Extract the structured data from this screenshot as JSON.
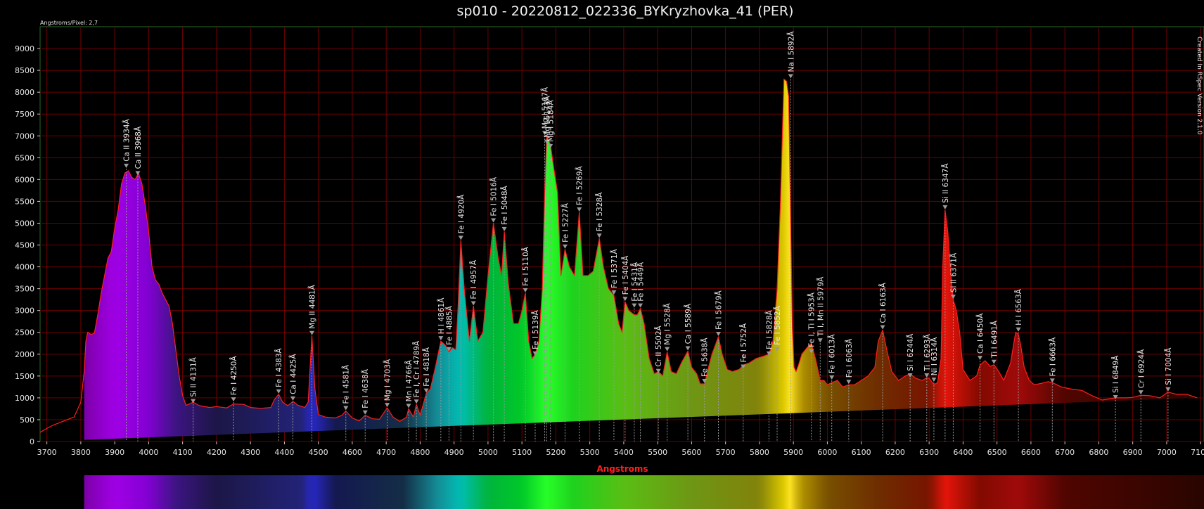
{
  "chart_data": {
    "type": "line",
    "title": "sp010 - 20220812_022336_BYKryzhovka_41 (PER)",
    "xlabel": "Angstroms",
    "ylabel": "",
    "dispersion_label": "Angstroms/Pixel: 2,7",
    "credit": "Created In RSpec Version 2.1.0",
    "xlim": [
      3680,
      7110
    ],
    "ylim": [
      0,
      9500
    ],
    "x_ticks": [
      3700,
      3800,
      3900,
      4000,
      4100,
      4200,
      4300,
      4400,
      4500,
      4600,
      4700,
      4800,
      4900,
      5000,
      5100,
      5200,
      5300,
      5400,
      5500,
      5600,
      5700,
      5800,
      5900,
      6000,
      6100,
      6200,
      6300,
      6400,
      6500,
      6600,
      6700,
      6800,
      6900,
      7000,
      7100
    ],
    "y_ticks": [
      0,
      500,
      1000,
      1500,
      2000,
      2500,
      3000,
      3500,
      4000,
      4500,
      5000,
      5500,
      6000,
      6500,
      7000,
      7500,
      8000,
      8500,
      9000
    ],
    "grid": true,
    "colors": {
      "curve": "#ff1e1e",
      "grid": "#6e0000",
      "frame": "#2a6a2a",
      "tick_text": "#e6e6e6",
      "axis_title": "#ff2020",
      "marker": "#9a9a9a"
    },
    "spectrum": {
      "x": [
        3680,
        3700,
        3720,
        3750,
        3780,
        3800,
        3810,
        3815,
        3820,
        3830,
        3840,
        3850,
        3860,
        3870,
        3880,
        3890,
        3900,
        3910,
        3920,
        3930,
        3940,
        3950,
        3960,
        3970,
        3980,
        3990,
        4000,
        4010,
        4020,
        4030,
        4040,
        4050,
        4060,
        4070,
        4080,
        4090,
        4100,
        4110,
        4120,
        4131,
        4150,
        4180,
        4200,
        4230,
        4250,
        4280,
        4300,
        4330,
        4360,
        4370,
        4383,
        4395,
        4410,
        4425,
        4440,
        4460,
        4470,
        4481,
        4490,
        4500,
        4520,
        4550,
        4570,
        4581,
        4600,
        4620,
        4638,
        4660,
        4680,
        4703,
        4720,
        4740,
        4760,
        4766,
        4780,
        4789,
        4800,
        4818,
        4830,
        4845,
        4861,
        4875,
        4885,
        4895,
        4905,
        4912,
        4920,
        4930,
        4945,
        4957,
        4970,
        4985,
        5000,
        5016,
        5030,
        5040,
        5048,
        5060,
        5075,
        5090,
        5100,
        5110,
        5120,
        5130,
        5139,
        5150,
        5160,
        5167,
        5173,
        5184,
        5195,
        5205,
        5215,
        5227,
        5240,
        5255,
        5269,
        5280,
        5295,
        5310,
        5328,
        5340,
        5355,
        5371,
        5385,
        5395,
        5404,
        5415,
        5431,
        5440,
        5449,
        5460,
        5475,
        5490,
        5502,
        5515,
        5528,
        5540,
        5555,
        5570,
        5589,
        5600,
        5615,
        5625,
        5638,
        5650,
        5660,
        5679,
        5690,
        5705,
        5720,
        5740,
        5752,
        5770,
        5790,
        5810,
        5828,
        5840,
        5852,
        5862,
        5872,
        5880,
        5886,
        5892,
        5897,
        5902,
        5908,
        5915,
        5925,
        5940,
        5953,
        5965,
        5979,
        5990,
        6000,
        6013,
        6030,
        6045,
        6063,
        6080,
        6100,
        6120,
        6140,
        6150,
        6163,
        6175,
        6190,
        6210,
        6230,
        6244,
        6260,
        6280,
        6293,
        6300,
        6314,
        6325,
        6335,
        6340,
        6347,
        6355,
        6362,
        6371,
        6380,
        6390,
        6400,
        6420,
        6440,
        6450,
        6465,
        6480,
        6491,
        6505,
        6520,
        6540,
        6555,
        6563,
        6570,
        6580,
        6595,
        6610,
        6630,
        6650,
        6663,
        6690,
        6720,
        6750,
        6780,
        6810,
        6849,
        6880,
        6900,
        6924,
        6950,
        6980,
        7004,
        7030,
        7060,
        7090,
        7110
      ],
      "y": [
        210,
        300,
        380,
        470,
        560,
        900,
        1600,
        2300,
        2500,
        2450,
        2480,
        2900,
        3400,
        3800,
        4200,
        4350,
        4900,
        5300,
        5900,
        6150,
        6200,
        6050,
        6000,
        6150,
        5900,
        5400,
        4800,
        4000,
        3700,
        3600,
        3400,
        3250,
        3100,
        2700,
        2100,
        1500,
        1050,
        830,
        860,
        900,
        820,
        780,
        800,
        770,
        860,
        850,
        780,
        760,
        780,
        950,
        1080,
        900,
        820,
        920,
        830,
        780,
        900,
        2420,
        1200,
        620,
        560,
        540,
        600,
        700,
        540,
        470,
        600,
        520,
        510,
        770,
        560,
        460,
        560,
        750,
        560,
        850,
        600,
        1100,
        1200,
        1700,
        2300,
        2200,
        2050,
        2150,
        2100,
        3100,
        4600,
        3500,
        2300,
        3100,
        2300,
        2500,
        3800,
        5000,
        4200,
        3800,
        4800,
        3600,
        2700,
        2700,
        3000,
        3400,
        2300,
        1900,
        2000,
        2300,
        3500,
        5700,
        7000,
        6800,
        6200,
        5700,
        3800,
        4400,
        4000,
        3800,
        5250,
        3800,
        3800,
        3900,
        4650,
        4000,
        3500,
        3350,
        2700,
        2500,
        3200,
        3000,
        2900,
        2900,
        3050,
        2700,
        1900,
        1550,
        1600,
        1500,
        2050,
        1600,
        1550,
        1800,
        2070,
        1700,
        1550,
        1320,
        1320,
        1700,
        2000,
        2400,
        2000,
        1650,
        1600,
        1650,
        1750,
        1800,
        1900,
        1950,
        2000,
        2300,
        3500,
        5500,
        8300,
        8250,
        7900,
        5000,
        2600,
        1700,
        1600,
        1750,
        2000,
        2150,
        2250,
        1900,
        1400,
        1400,
        1300,
        1350,
        1400,
        1250,
        1300,
        1300,
        1400,
        1500,
        1700,
        2300,
        2550,
        2100,
        1600,
        1400,
        1500,
        1550,
        1450,
        1400,
        1460,
        1450,
        1300,
        1350,
        1900,
        4000,
        5300,
        4800,
        4000,
        3250,
        3000,
        2500,
        1650,
        1400,
        1500,
        1750,
        1850,
        1720,
        1760,
        1600,
        1400,
        1800,
        2500,
        2450,
        2200,
        1700,
        1400,
        1300,
        1330,
        1370,
        1350,
        1250,
        1200,
        1170,
        1050,
        950,
        1000,
        1000,
        1010,
        1060,
        1050,
        1000,
        1130,
        1080,
        1080,
        1000
      ]
    },
    "spectrum_band": {
      "x_start": 3810,
      "x_end": 7110
    },
    "line_labels": [
      {
        "label": "Ca II 3934Å",
        "x": 3934,
        "y": 6250
      },
      {
        "label": "Ca II 3968Å",
        "x": 3968,
        "y": 6080
      },
      {
        "label": "Si II 4131Å",
        "x": 4131,
        "y": 860
      },
      {
        "label": "Fe I 4250Å",
        "x": 4250,
        "y": 900
      },
      {
        "label": "Fe I 4383Å",
        "x": 4383,
        "y": 1080
      },
      {
        "label": "Ca I 4425Å",
        "x": 4425,
        "y": 920
      },
      {
        "label": "Mg II 4481Å",
        "x": 4481,
        "y": 2420
      },
      {
        "label": "Fe I 4581Å",
        "x": 4581,
        "y": 700
      },
      {
        "label": "Fe I 4638Å",
        "x": 4638,
        "y": 600
      },
      {
        "label": "Mg I 4703Å",
        "x": 4703,
        "y": 770
      },
      {
        "label": "Mn I 4766Å",
        "x": 4766,
        "y": 750
      },
      {
        "label": "Fe I, Cr I 4789Å",
        "x": 4789,
        "y": 850
      },
      {
        "label": "Fe I 4818Å",
        "x": 4818,
        "y": 1100
      },
      {
        "label": "H I 4861Å",
        "x": 4861,
        "y": 2300
      },
      {
        "label": "Fe I 4885Å",
        "x": 4885,
        "y": 2050
      },
      {
        "label": "Fe I 4920Å",
        "x": 4920,
        "y": 4600
      },
      {
        "label": "Fe I 4957Å",
        "x": 4957,
        "y": 3100
      },
      {
        "label": "Fe I 5016Å",
        "x": 5016,
        "y": 5000
      },
      {
        "label": "Fe I 5048Å",
        "x": 5048,
        "y": 4800
      },
      {
        "label": "Fe I 5110Å",
        "x": 5110,
        "y": 3400
      },
      {
        "label": "Fe I 5139Å",
        "x": 5139,
        "y": 1950
      },
      {
        "label": "Mg I 5167Å",
        "x": 5167,
        "y": 7000
      },
      {
        "label": "Mg I 5173Å",
        "x": 5173,
        "y": 6800
      },
      {
        "label": "Mg I 5184Å",
        "x": 5184,
        "y": 6700
      },
      {
        "label": "Fe I 5227Å",
        "x": 5227,
        "y": 4400
      },
      {
        "label": "Fe I 5269Å",
        "x": 5269,
        "y": 5250
      },
      {
        "label": "Fe I 5328Å",
        "x": 5328,
        "y": 4650
      },
      {
        "label": "Fe I 5371Å",
        "x": 5371,
        "y": 3350
      },
      {
        "label": "Fe I 5404Å",
        "x": 5404,
        "y": 3200
      },
      {
        "label": "Fe I 5431Å",
        "x": 5431,
        "y": 3050
      },
      {
        "label": "Fe I 5449Å",
        "x": 5449,
        "y": 3050
      },
      {
        "label": "Cr II 5502Å",
        "x": 5502,
        "y": 1550
      },
      {
        "label": "Mg I 5528Å",
        "x": 5528,
        "y": 2050
      },
      {
        "label": "Ca I 5589Å",
        "x": 5589,
        "y": 2070
      },
      {
        "label": "Fe I 5638Å",
        "x": 5638,
        "y": 1320
      },
      {
        "label": "Fe I 5679Å",
        "x": 5679,
        "y": 2400
      },
      {
        "label": "Fe I 5752Å",
        "x": 5752,
        "y": 1650
      },
      {
        "label": "Fe I 5828Å",
        "x": 5828,
        "y": 1950
      },
      {
        "label": "Fe I 5852Å",
        "x": 5852,
        "y": 2050
      },
      {
        "label": "Na I 5892Å",
        "x": 5892,
        "y": 8300
      },
      {
        "label": "Fe I, Ti I 5953Å",
        "x": 5953,
        "y": 2000
      },
      {
        "label": "Ti I, Mn II 5979Å",
        "x": 5979,
        "y": 2250
      },
      {
        "label": "Fe I 6013Å",
        "x": 6013,
        "y": 1400
      },
      {
        "label": "Fe I 6063Å",
        "x": 6063,
        "y": 1300
      },
      {
        "label": "Ca I 6163Å",
        "x": 6163,
        "y": 2550
      },
      {
        "label": "Si I 6244Å",
        "x": 6244,
        "y": 1450
      },
      {
        "label": "Ti I 6293Å",
        "x": 6293,
        "y": 1450
      },
      {
        "label": "Ni I 6314Å",
        "x": 6314,
        "y": 1350
      },
      {
        "label": "Si II 6347Å",
        "x": 6347,
        "y": 5300
      },
      {
        "label": "Si II 6371Å",
        "x": 6371,
        "y": 3250
      },
      {
        "label": "Ca I 6450Å",
        "x": 6450,
        "y": 1850
      },
      {
        "label": "Ti I 6491Å",
        "x": 6491,
        "y": 1760
      },
      {
        "label": "H I 6563Å",
        "x": 6563,
        "y": 2500
      },
      {
        "label": "Fe I 6663Å",
        "x": 6663,
        "y": 1330
      },
      {
        "label": "Si I 6849Å",
        "x": 6849,
        "y": 950
      },
      {
        "label": "Cr I 6924Å",
        "x": 6924,
        "y": 1060
      },
      {
        "label": "Si I 7004Å",
        "x": 7004,
        "y": 1130
      }
    ]
  }
}
